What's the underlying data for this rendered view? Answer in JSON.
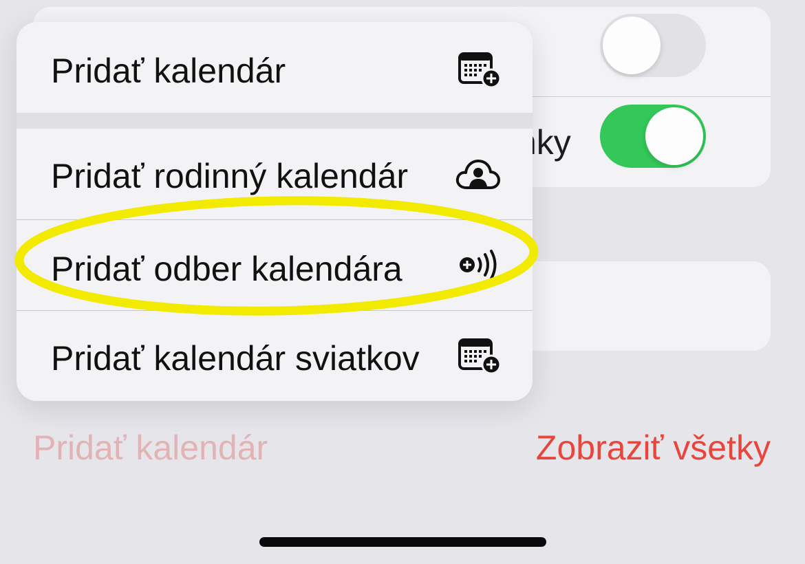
{
  "background": {
    "row_label_partial": "nky",
    "toggle_top_state": "off",
    "toggle_second_state": "on",
    "add_calendar_link": "Pridať kalendár",
    "show_all_link": "Zobraziť všetky"
  },
  "menu": {
    "items": [
      {
        "label": "Pridať kalendár",
        "icon": "calendar-add-icon"
      },
      {
        "label": "Pridať rodinný kalendár",
        "icon": "cloud-person-icon"
      },
      {
        "label": "Pridať odber kalendára",
        "icon": "subscribe-broadcast-icon"
      },
      {
        "label": "Pridať kalendár sviatkov",
        "icon": "calendar-add-icon"
      }
    ]
  },
  "colors": {
    "accent_red": "#e8453c",
    "toggle_on": "#34c759",
    "highlight": "#f2ea00"
  }
}
